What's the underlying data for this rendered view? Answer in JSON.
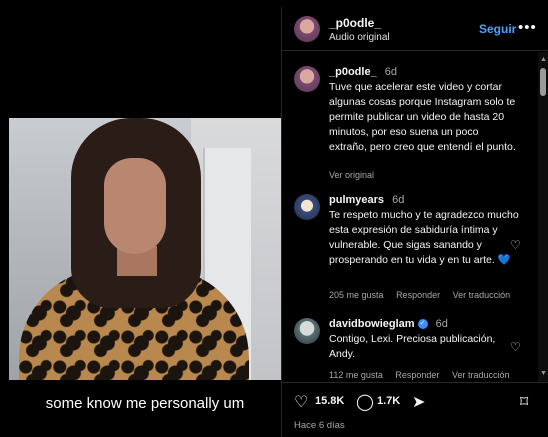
{
  "video": {
    "subtitle": "some know me personally um"
  },
  "header": {
    "username": "_p0odle_",
    "audio": "Audio original",
    "follow_label": "Seguir",
    "more_icon": "more-horizontal-icon"
  },
  "caption": {
    "username": "_p0odle_",
    "time": "6d",
    "text": "Tuve que acelerar este video y cortar algunas cosas porque Instagram solo te permite publicar un video de hasta 20 minutos, por eso suena un poco extraño, pero creo que entendí el punto.",
    "translation_link": "Ver original"
  },
  "comments": [
    {
      "username": "pulmyears",
      "time": "6d",
      "text": "Te respeto mucho y te agradezco mucho esta expresión de sabiduría íntima y vulnerable. Que sigas sanando y prosperando en tu vida y en tu arte. 💙",
      "likes": "205 me gusta",
      "reply": "Responder",
      "translation": "Ver traducción"
    },
    {
      "username": "davidbowieglam",
      "verified": true,
      "time": "6d",
      "text": "Contigo, Lexi. Preciosa publicación, Andy.",
      "likes": "112 me gusta",
      "reply": "Responder",
      "translation": "Ver traducción"
    }
  ],
  "actions": {
    "likes_count": "15.8K",
    "comments_count": "1.7K",
    "date": "Hace 6 días"
  },
  "colors": {
    "accent": "#4aa3ff",
    "background": "#000000",
    "muted_text": "#a8a8a8"
  }
}
